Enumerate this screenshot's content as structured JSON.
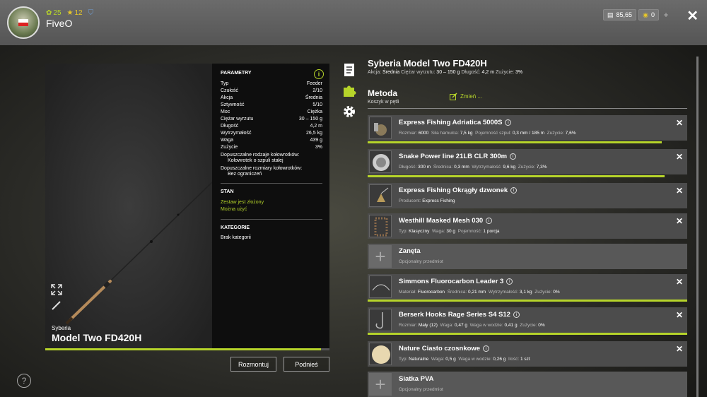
{
  "player": {
    "name": "FiveO",
    "level": "25",
    "stars": "12",
    "rank": "",
    "money": "85,65",
    "gold": "0"
  },
  "rod": {
    "brand": "Syberia",
    "name": "Model Two FD420H"
  },
  "params": {
    "title": "PARAMETRY",
    "rows": [
      {
        "label": "Typ",
        "value": "Feeder"
      },
      {
        "label": "Czułość",
        "value": "2/10"
      },
      {
        "label": "Akcja",
        "value": "Średnia"
      },
      {
        "label": "Sztywność",
        "value": "5/10"
      },
      {
        "label": "Moc",
        "value": "Ciężka"
      },
      {
        "label": "Ciężar wyrzutu",
        "value": "30 – 150 g"
      },
      {
        "label": "Długość",
        "value": "4,2 m"
      },
      {
        "label": "Wytrzymałość",
        "value": "26,5 kg"
      },
      {
        "label": "Waga",
        "value": "439 g"
      },
      {
        "label": "Zużycie",
        "value": "3%"
      }
    ],
    "reel_types_label": "Dopuszczalne rodzaje kołowrotków:",
    "reel_types_value": "Kołowrotek o szpuli stałej",
    "reel_sizes_label": "Dopuszczalne rozmiary kołowrotków:",
    "reel_sizes_value": "Bez ograniczeń",
    "state_title": "STAN",
    "state_1": "Zestaw jest złożony",
    "state_2": "Można użyć",
    "cat_title": "KATEGORIE",
    "cat_value": "Brak kategorii"
  },
  "buttons": {
    "dismantle": "Rozmontuj",
    "pickup": "Podnieś"
  },
  "right": {
    "title": "Syberia Model Two FD420H",
    "sub_akcja_l": "Akcja:",
    "sub_akcja_v": "Średnia",
    "sub_ciezar_l": "Ciężar wyrzutu:",
    "sub_ciezar_v": "30 – 150 g",
    "sub_dl_l": "Długość:",
    "sub_dl_v": "4,2 m",
    "sub_zu_l": "Zużycie:",
    "sub_zu_v": "3%",
    "method": "Metoda",
    "method_sub": "Koszyk w pętli",
    "change": "Zmień ..."
  },
  "slots": [
    {
      "name": "Express Fishing Adriatica 5000S",
      "info": [
        [
          "Rozmiar:",
          "6000"
        ],
        [
          "Siła hamulca:",
          "7,5 kg"
        ],
        [
          "Pojemność szpul:",
          "0,3 mm / 185 m"
        ],
        [
          "Zużycie:",
          "7,6%"
        ]
      ],
      "bar": 0.92
    },
    {
      "name": "Snake Power line 21LB CLR 300m",
      "info": [
        [
          "Długość:",
          "300 m"
        ],
        [
          "Średnica:",
          "0,3 mm"
        ],
        [
          "Wytrzymałość:",
          "9,6 kg"
        ],
        [
          "Zużycie:",
          "7,3%"
        ]
      ],
      "bar": 0.93
    },
    {
      "name": "Express Fishing Okrągły dzwonek",
      "info": [
        [
          "Producent:",
          "Express Fishing"
        ]
      ]
    },
    {
      "name": "Westhill Masked Mesh 030",
      "info": [
        [
          "Typ:",
          "Klasyczny"
        ],
        [
          "Waga:",
          "30 g"
        ],
        [
          "Pojemność:",
          "1 porcja"
        ]
      ]
    },
    {
      "name": "Zanęta",
      "info": [
        [
          "Opcjonalny przedmiot",
          ""
        ]
      ]
    },
    {
      "name": "Simmons Fluorocarbon Leader 3",
      "info": [
        [
          "Materiał:",
          "Fluorocarbon"
        ],
        [
          "Średnica:",
          "0,21 mm"
        ],
        [
          "Wytrzymałość:",
          "3,1 kg"
        ],
        [
          "Zużycie:",
          "0%"
        ]
      ],
      "bar": 1.0
    },
    {
      "name": "Berserk Hooks Rage Series S4 S12",
      "info": [
        [
          "Rozmiar:",
          "Mały (12)"
        ],
        [
          "Waga:",
          "0,47 g"
        ],
        [
          "Waga w wodzie:",
          "0,41 g"
        ],
        [
          "Zużycie:",
          "0%"
        ]
      ],
      "bar": 1.0
    },
    {
      "name": "Nature Ciasto czosnkowe",
      "info": [
        [
          "Typ:",
          "Naturalne"
        ],
        [
          "Waga:",
          "0,5 g"
        ],
        [
          "Waga w wodzie:",
          "0,26 g"
        ],
        [
          "Ilość:",
          "1 szt"
        ]
      ]
    },
    {
      "name": "Siatka PVA",
      "info": [
        [
          "Opcjonalny przedmiot",
          ""
        ]
      ]
    }
  ]
}
